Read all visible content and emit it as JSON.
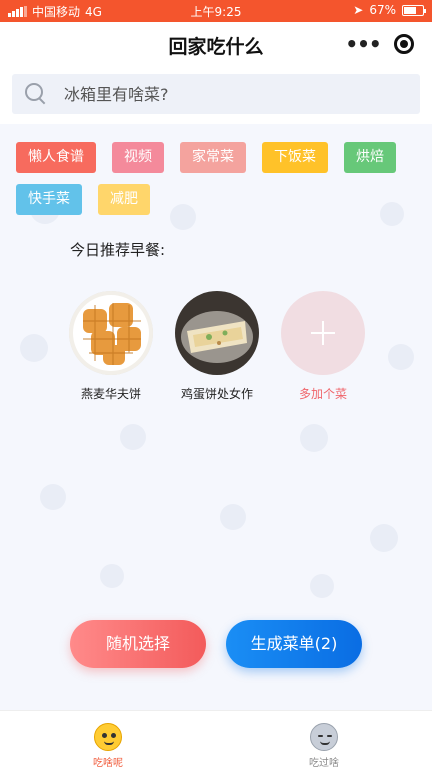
{
  "status_bar": {
    "carrier": "中国移动",
    "network": "4G",
    "time": "上午9:25",
    "battery": "67%"
  },
  "navbar": {
    "title": "回家吃什么",
    "more_glyph": "•••"
  },
  "search": {
    "placeholder": "冰箱里有啥菜?"
  },
  "tags": [
    {
      "label": "懒人食谱",
      "color": "#f76b5e"
    },
    {
      "label": "视频",
      "color": "#f48a9b"
    },
    {
      "label": "家常菜",
      "color": "#f4a39e"
    },
    {
      "label": "下饭菜",
      "color": "#ffc229"
    },
    {
      "label": "烘焙",
      "color": "#67c879"
    },
    {
      "label": "快手菜",
      "color": "#62c2ea"
    },
    {
      "label": "减肥",
      "color": "#ffd66b"
    }
  ],
  "recommendation": {
    "title": "今日推荐早餐:",
    "dishes": [
      {
        "name": "燕麦华夫饼"
      },
      {
        "name": "鸡蛋饼处女作"
      }
    ],
    "add_label": "多加个菜"
  },
  "actions": {
    "random_label": "随机选择",
    "menu_label": "生成菜单(2)"
  },
  "tabbar": {
    "home_label": "吃啥呢",
    "history_label": "吃过啥"
  },
  "colors": {
    "status_bar": "#f4552d",
    "accent_red": "#f35b5b",
    "accent_blue": "#0a6de3"
  }
}
